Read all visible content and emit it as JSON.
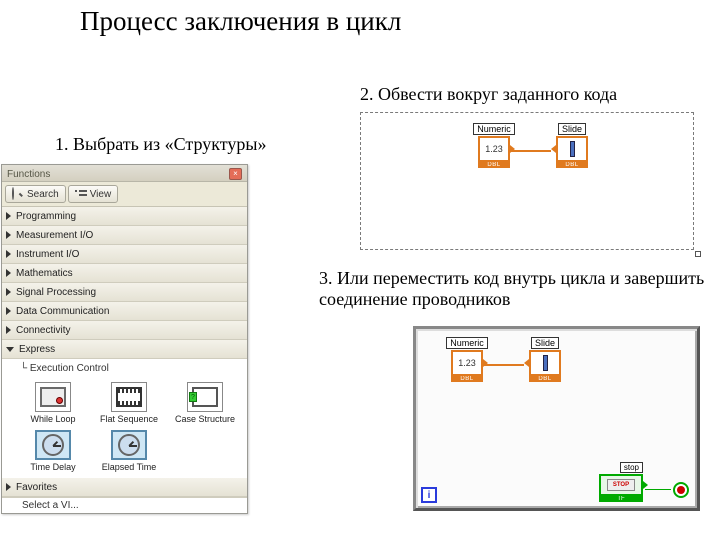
{
  "title": "Процесс заключения в цикл",
  "steps": {
    "s1": "1. Выбрать из «Структуры»",
    "s2": "2. Обвести вокруг заданного кода",
    "s3": "3.  Или переместить код внутрь цикла и завершить соединение проводников"
  },
  "palette": {
    "title": "Functions",
    "search_label": "Search",
    "view_label": "View",
    "categories": [
      "Programming",
      "Measurement I/O",
      "Instrument I/O",
      "Mathematics",
      "Signal Processing",
      "Data Communication",
      "Connectivity",
      "Express"
    ],
    "expanded_sub": "Execution Control",
    "items": [
      "While Loop",
      "Flat Sequence",
      "Case Structure",
      "Time Delay",
      "Elapsed Time"
    ],
    "favorites": "Favorites",
    "select_vi": "Select a VI..."
  },
  "diagram": {
    "numeric_label": "Numeric",
    "numeric_value": "1.23",
    "slide_label": "Slide",
    "dtype": "DBL",
    "stop_label": "stop",
    "stop_btn": "STOP",
    "stop_type": "TF",
    "i_label": "i"
  }
}
